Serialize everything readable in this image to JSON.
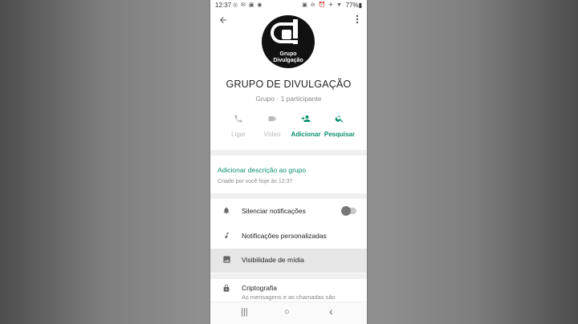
{
  "status": {
    "time": "12:37",
    "left_icons": "◎ ✉ ▣ ◉",
    "right_icons": "▣ ⊖ ⏰ ✈ ▼",
    "battery": "77%▮"
  },
  "header": {
    "back_icon": "arrow-left-icon",
    "menu_icon": "more-vert-icon"
  },
  "group": {
    "avatar_caption_1": "Grupo",
    "avatar_caption_2": "Divulgação",
    "name": "GRUPO DE DIVULGAÇÃO",
    "meta": "Grupo · 1 participante"
  },
  "actions": [
    {
      "label": "Ligar",
      "icon": "phone-icon",
      "state": "disabled"
    },
    {
      "label": "Vídeo",
      "icon": "video-icon",
      "state": "disabled"
    },
    {
      "label": "Adicionar",
      "icon": "person-add-icon",
      "state": "active"
    },
    {
      "label": "Pesquisar",
      "icon": "search-icon",
      "state": "active"
    }
  ],
  "description": {
    "link": "Adicionar descrição ao grupo",
    "created": "Criado por você hoje às 12:37"
  },
  "settings": [
    {
      "label": "Silenciar notificações",
      "icon": "bell-icon",
      "toggle": false
    },
    {
      "label": "Notificações personalizadas",
      "icon": "music-note-icon"
    },
    {
      "label": "Visibilidade de mídia",
      "icon": "image-icon"
    },
    {
      "label": "Criptografia",
      "icon": "lock-icon",
      "sub": "As mensagens e as chamadas são"
    }
  ],
  "colors": {
    "accent": "#0a8f6f",
    "disabled": "#b9b9b9"
  },
  "nav": {
    "recents": "|||",
    "home": "○",
    "back": "‹"
  }
}
